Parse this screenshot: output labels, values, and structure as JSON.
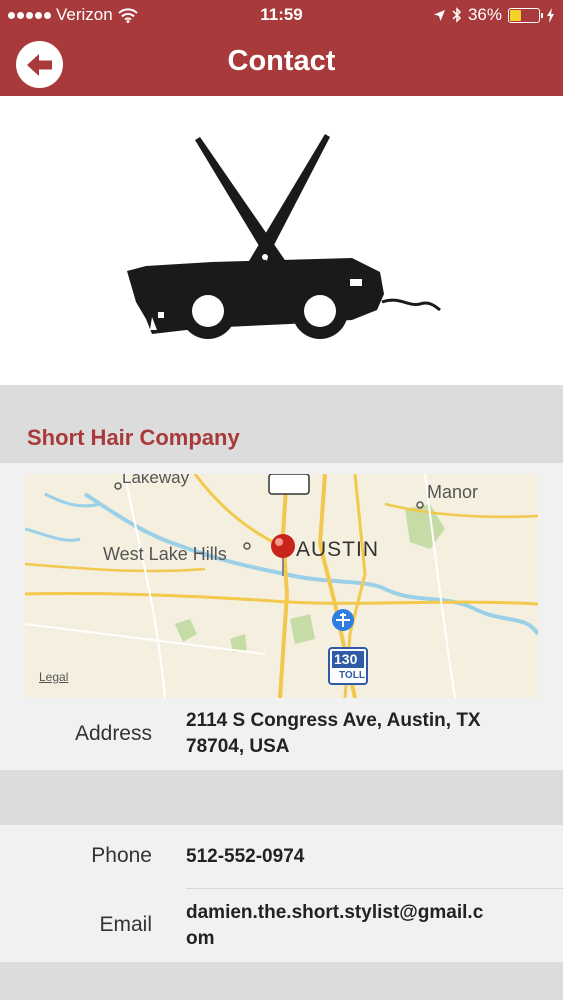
{
  "status_bar": {
    "carrier": "Verizon",
    "time": "11:59",
    "battery": "36%",
    "battery_level": 0.36,
    "icons": [
      "signal-dots-icon",
      "wifi-icon",
      "location-arrow-icon",
      "bluetooth-icon",
      "battery-icon",
      "charging-bolt-icon"
    ]
  },
  "nav": {
    "title": "Contact",
    "back_icon": "back-arrow-icon"
  },
  "logo": {
    "icon": "scissors-clipper-logo"
  },
  "company": {
    "name": "Short Hair Company"
  },
  "map": {
    "labels": {
      "lakeway": "Lakeway",
      "manor": "Manor",
      "west_lake_hills": "West Lake Hills",
      "austin": "AUSTIN",
      "highway": "130",
      "toll": "TOLL",
      "legal": "Legal"
    },
    "pin_color": "#c8241c"
  },
  "contact": {
    "address_label": "Address",
    "address_line1": "2114 S Congress Ave, Austin, TX",
    "address_line2": "78704, USA",
    "phone_label": "Phone",
    "phone": "512-552-0974",
    "email_label": "Email",
    "email_line1": "damien.the.short.stylist@gmail.c",
    "email_line2": "om"
  },
  "colors": {
    "brand": "#a93a3b",
    "battery_fill": "#f7d32a"
  }
}
